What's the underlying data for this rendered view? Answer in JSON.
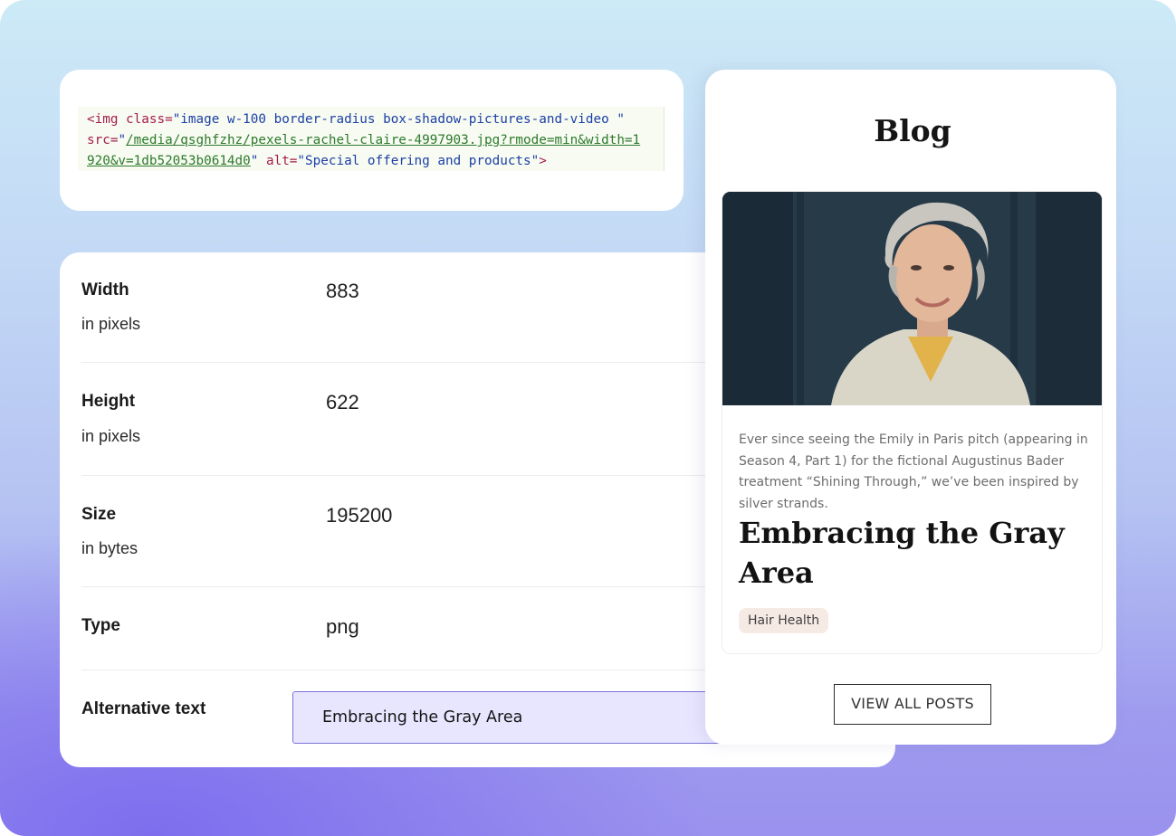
{
  "code_snippet": {
    "line1_tag_open": "<img",
    "line1_attr_class": " class=",
    "line1_val_class": "\"image w-100 border-radius box-shadow-pictures-and-video \"",
    "line2_attr_src": "src=",
    "line2_quote_open": "\"",
    "line2_link": "/media/qsghfzhz/pexels-rachel-claire-4997903.jpg?rmode=min&width=1",
    "line3_link": "920&v=1db52053b0614d0",
    "line3_quote_close": "\"",
    "line3_attr_alt": " alt=",
    "line3_val_alt": "\"Special offering and products\"",
    "line3_tag_close": ">"
  },
  "properties": {
    "width": {
      "label": "Width",
      "sub": "in pixels",
      "value": "883"
    },
    "height": {
      "label": "Height",
      "sub": "in pixels",
      "value": "622"
    },
    "size": {
      "label": "Size",
      "sub": "in bytes",
      "value": "195200"
    },
    "type": {
      "label": "Type",
      "value": "png"
    },
    "alt": {
      "label": "Alternative text",
      "value": "Embracing the Gray Area"
    }
  },
  "blog": {
    "heading": "Blog",
    "post": {
      "excerpt": "Ever since seeing the Emily in Paris pitch (appearing in Season 4, Part 1) for the fictional Augustinus Bader treatment “Shining Through,” we’ve been inspired by silver strands.",
      "title": "Embracing the Gray Area",
      "tag": "Hair Health"
    },
    "view_all_label": "VIEW ALL POSTS"
  },
  "colors": {
    "accent_input_bg": "#e8e6ff",
    "accent_input_border": "#7b72d8",
    "tag_bg": "#f6ebe4"
  }
}
